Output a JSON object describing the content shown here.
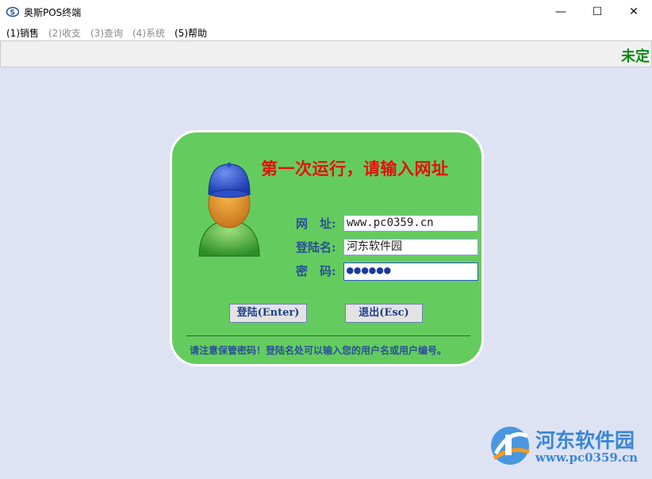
{
  "window": {
    "title": "奥斯POS终端",
    "minimize": "—",
    "maximize": "☐",
    "close": "✕"
  },
  "menu": [
    {
      "label": "(1)销售",
      "enabled": true
    },
    {
      "label": "(2)收支",
      "enabled": false
    },
    {
      "label": "(3)查询",
      "enabled": false
    },
    {
      "label": "(4)系统",
      "enabled": false
    },
    {
      "label": "(5)帮助",
      "enabled": true
    }
  ],
  "status": {
    "text": "未定"
  },
  "login": {
    "heading": "第一次运行，请输入网址",
    "fields": {
      "url_label": "网　址:",
      "url_value": "www.pc0359.cn",
      "username_label": "登陆名:",
      "username_value": "河东软件园",
      "password_label": "密　码:",
      "password_value": "●●●●●●"
    },
    "login_button": "登陆(Enter)",
    "exit_button": "退出(Esc)",
    "hint": "请注意保管密码！登陆名处可以输入您的用户名或用户编号。"
  },
  "watermark": {
    "line1": "河东软件园",
    "line2": "www.pc0359.cn"
  },
  "colors": {
    "panel": "#64cc5e",
    "heading": "#e41010",
    "label": "#2a4f9a",
    "status": "#0c8a12",
    "background": "#dde3f3"
  }
}
